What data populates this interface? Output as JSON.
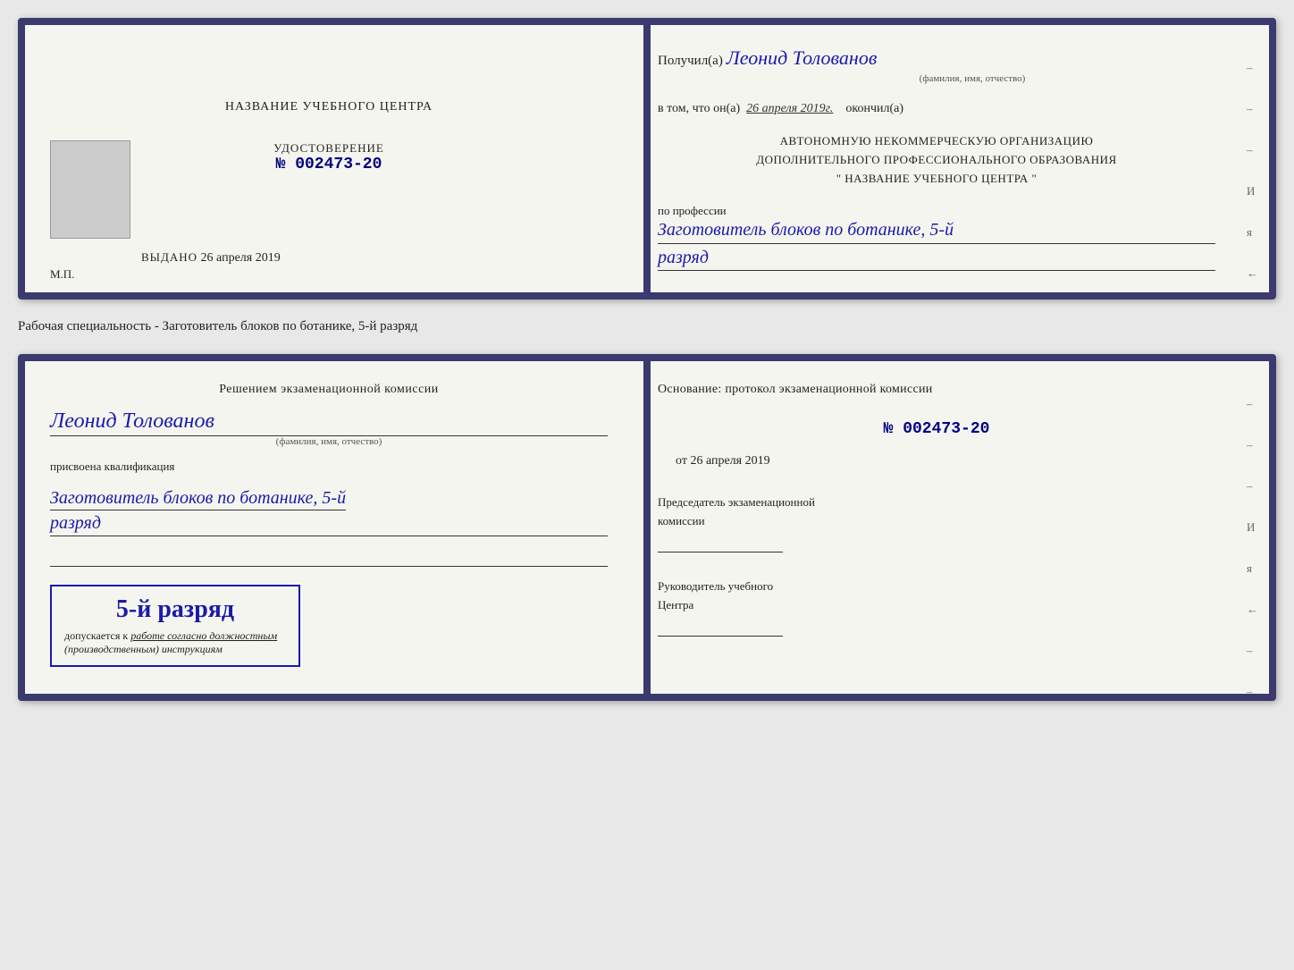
{
  "top_cert": {
    "left": {
      "center_name": "НАЗВАНИЕ УЧЕБНОГО ЦЕНТРА",
      "cert_label": "УДОСТОВЕРЕНИЕ",
      "cert_number_prefix": "№",
      "cert_number": "002473-20",
      "issued_label": "Выдано",
      "issued_date": "26 апреля 2019",
      "mp_label": "М.П."
    },
    "right": {
      "received_prefix": "Получил(а)",
      "received_name": "Леонид Толованов",
      "received_sub": "(фамилия, имя, отчество)",
      "date_prefix": "в том, что он(а)",
      "date_value": "26 апреля 2019г.",
      "date_suffix": "окончил(а)",
      "org_line1": "АВТОНОМНУЮ НЕКОММЕРЧЕСКУЮ ОРГАНИЗАЦИЮ",
      "org_line2": "ДОПОЛНИТЕЛЬНОГО ПРОФЕССИОНАЛЬНОГО ОБРАЗОВАНИЯ",
      "org_line3": "\"  НАЗВАНИЕ УЧЕБНОГО ЦЕНТРА  \"",
      "profession_label": "по профессии",
      "profession_value": "Заготовитель блоков по ботанике, 5-й",
      "razryad_value": "разряд",
      "dash1": "–",
      "dash2": "–",
      "dash3": "–",
      "dash4": "И",
      "dash5": "я",
      "dash6": "←",
      "dash7": "–"
    }
  },
  "specialty_label": "Рабочая специальность - Заготовитель блоков по ботанике, 5-й разряд",
  "bottom_cert": {
    "left": {
      "decision_text": "Решением экзаменационной комиссии",
      "person_name": "Леонид Толованов",
      "person_sub": "(фамилия, имя, отчество)",
      "assigned_label": "присвоена квалификация",
      "qualification": "Заготовитель блоков по ботанике, 5-й",
      "razryad": "разряд",
      "stamp_rank": "5-й разряд",
      "stamp_allowed_prefix": "допускается к",
      "stamp_allowed_underline": "работе согласно должностным",
      "stamp_allowed_italic": "(производственным) инструкциям"
    },
    "right": {
      "basis_label": "Основание: протокол экзаменационной комиссии",
      "protocol_prefix": "№",
      "protocol_number": "002473-20",
      "date_prefix": "от",
      "date_value": "26 апреля 2019",
      "chairman_label": "Председатель экзаменационной",
      "chairman_label2": "комиссии",
      "head_label1": "Руководитель учебного",
      "head_label2": "Центра",
      "dash1": "–",
      "dash2": "–",
      "dash3": "–",
      "dash4": "И",
      "dash5": "я",
      "dash6": "←",
      "dash7": "–",
      "dash8": "–",
      "dash9": "–"
    }
  }
}
